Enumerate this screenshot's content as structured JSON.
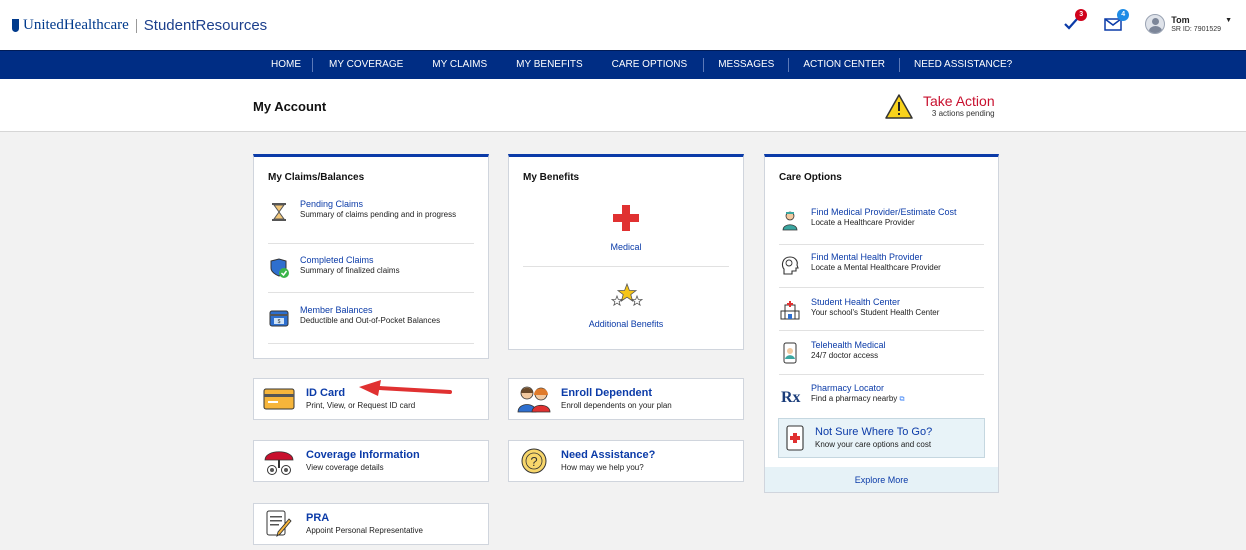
{
  "brand": {
    "name": "UnitedHealthcare",
    "product": "StudentResources"
  },
  "header": {
    "actions_badge": "3",
    "messages_badge": "4",
    "user_name": "Tom",
    "user_id": "SR ID: 7901529"
  },
  "nav": [
    "HOME",
    "MY COVERAGE",
    "MY CLAIMS",
    "MY BENEFITS",
    "CARE OPTIONS",
    "MESSAGES",
    "ACTION CENTER",
    "NEED ASSISTANCE?"
  ],
  "account": {
    "title": "My Account",
    "take_action": "Take Action",
    "pending": "3 actions pending"
  },
  "claims": {
    "title": "My Claims/Balances",
    "items": [
      {
        "title": "Pending Claims",
        "sub": "Summary of claims pending and in progress",
        "icon": "hourglass-icon"
      },
      {
        "title": "Completed Claims",
        "sub": "Summary of finalized claims",
        "icon": "shield-check-icon"
      },
      {
        "title": "Member Balances",
        "sub": "Deductible and Out-of-Pocket Balances",
        "icon": "wallet-icon"
      }
    ]
  },
  "benefits": {
    "title": "My Benefits",
    "medical": "Medical",
    "additional": "Additional Benefits"
  },
  "care": {
    "title": "Care Options",
    "items": [
      {
        "title": "Find Medical Provider/Estimate Cost",
        "sub": "Locate a Healthcare Provider",
        "icon": "doctor-icon"
      },
      {
        "title": "Find Mental Health Provider",
        "sub": "Locate a Mental Healthcare Provider",
        "icon": "head-icon"
      },
      {
        "title": "Student Health Center",
        "sub": "Your school's Student Health Center",
        "icon": "hospital-icon"
      },
      {
        "title": "Telehealth Medical",
        "sub": "24/7 doctor access",
        "icon": "phone-doctor-icon"
      },
      {
        "title": "Pharmacy Locator",
        "sub": "Find a pharmacy nearby",
        "icon": "rx-icon"
      }
    ],
    "not_sure_title": "Not Sure Where To Go?",
    "not_sure_sub": "Know your care options and cost",
    "explore": "Explore More"
  },
  "tiles": {
    "id_card": {
      "title": "ID Card",
      "sub": "Print, View, or Request ID card"
    },
    "enroll": {
      "title": "Enroll Dependent",
      "sub": "Enroll dependents on your plan"
    },
    "coverage": {
      "title": "Coverage Information",
      "sub": "View coverage details"
    },
    "assist": {
      "title": "Need Assistance?",
      "sub": "How may we help you?"
    },
    "pra": {
      "title": "PRA",
      "sub": "Appoint Personal Representative"
    }
  },
  "colors": {
    "brand_blue": "#002d84",
    "link_blue": "#0b3ba8",
    "alert_red": "#c8102e"
  }
}
